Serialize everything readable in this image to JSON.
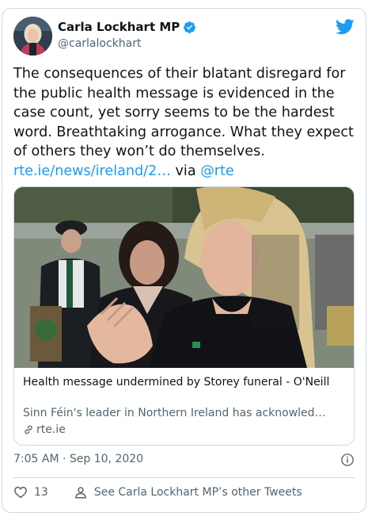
{
  "tweet": {
    "author": {
      "name": "Carla Lockhart MP",
      "handle": "@carlalockhart",
      "verified": true
    },
    "text_main": "The consequences of their blatant disregard for the public health message is evidenced in the case count, yet sorry seems to be the hardest word. Breathtaking arrogance. What they expect of others they won’t do themselves.",
    "link_text": "rte.ie/news/ireland/2…",
    "via_text": "via",
    "via_mention": "@rte",
    "link_card": {
      "title": "Health message undermined by Storey funeral - O'Neill",
      "description": "Sinn Féin's leader in Northern Ireland has acknowled…",
      "domain": "rte.ie"
    },
    "timestamp": "7:05 AM · Sep 10, 2020",
    "like_count": "13",
    "other_tweets_label": "See Carla Lockhart MP’s other Tweets"
  },
  "colors": {
    "link": "#1d9bf0",
    "secondary_text": "#536471",
    "border": "#cfd9de"
  },
  "icons": [
    "twitter-bird-icon",
    "verified-badge-icon",
    "info-icon",
    "heart-icon",
    "person-icon",
    "link-icon"
  ]
}
